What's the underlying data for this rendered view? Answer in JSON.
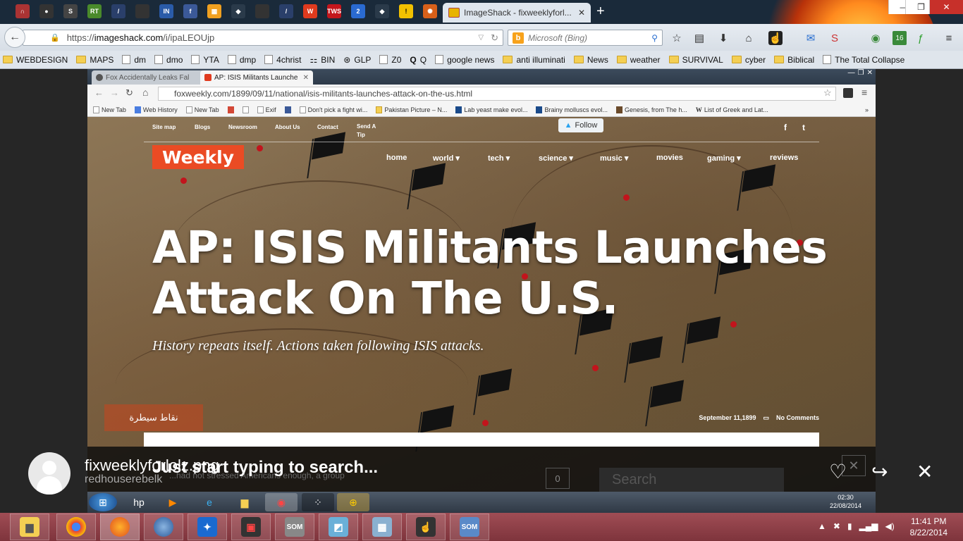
{
  "browser": {
    "tab_title": "ImageShack - fixweeklyforl...",
    "url_prefix": "https://",
    "url_host": "imageshack.com",
    "url_path": "/i/ipaLEOUjp",
    "search_placeholder": "Microsoft (Bing)",
    "window_controls": {
      "minimize": "—",
      "maximize": "❐",
      "close": "✕"
    }
  },
  "bookmarks": [
    "WEBDESIGN",
    "MAPS",
    "dm",
    "dmo",
    "YTA",
    "dmp",
    "4christ",
    "BIN",
    "GLP",
    "Z0",
    "Q",
    "google news",
    "anti illuminati",
    "News",
    "weather",
    "SURVIVAL",
    "cyber",
    "Biblical",
    "The Total Collapse"
  ],
  "inner_browser": {
    "tabs": [
      "Fox Accidentally Leaks Fal",
      "AP: ISIS Militants Launche"
    ],
    "url": "foxweekly.com/1899/09/11/national/isis-militants-launches-attack-on-the-us.html",
    "bookmarks": [
      "New Tab",
      "Web History",
      "New Tab",
      "Exif",
      "Don't pick a fight wi...",
      "Pakistan Picture – N...",
      "Lab yeast make evol...",
      "Brainy molluscs evol...",
      "Genesis, from The h...",
      "List of Greek and Lat..."
    ],
    "more": "»"
  },
  "site": {
    "top_links": [
      "Site map",
      "Blogs",
      "Newsroom",
      "About Us",
      "Contact",
      "Send A Tip"
    ],
    "follow": "Follow",
    "logo": "Weekly",
    "menu": [
      "home",
      "world ▾",
      "tech ▾",
      "science ▾",
      "music ▾",
      "movies",
      "gaming ▾",
      "reviews"
    ],
    "headline": "AP: ISIS Militants Launches Attack On The U.S.",
    "subhead": "History repeats itself. Actions taken following ISIS attacks.",
    "date": "September 11,1899",
    "comments": "No Comments",
    "map_box": "نقاط سيطرة"
  },
  "overlay": {
    "prompt": "Just start typing to search...",
    "excerpt": "...had not stressed Americans enough, a group",
    "count": "0",
    "search": "Search",
    "close": "✕"
  },
  "inner_clock": {
    "time": "02:30",
    "date": "22/08/2014"
  },
  "uploader": {
    "title": "fixweeklyforlolz.png",
    "user": "redhouserebelk"
  },
  "clock": {
    "time": "11:41 PM",
    "date": "8/22/2014"
  }
}
